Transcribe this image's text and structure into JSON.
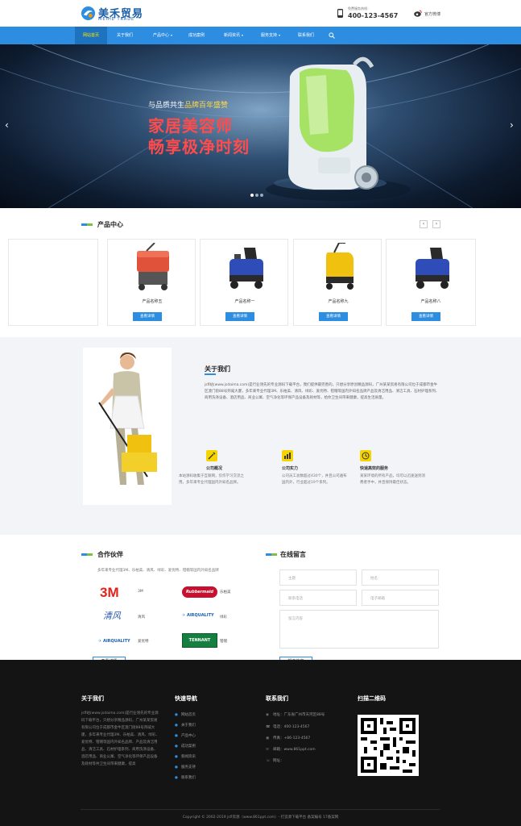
{
  "header": {
    "logo_cn": "美禾贸易",
    "logo_en": "MEIHE TRADE",
    "hotline_label": "免费服务热线：",
    "hotline": "400-123-4567",
    "weibo": "官方微博"
  },
  "nav": {
    "items": [
      {
        "label": "网站首页",
        "dropdown": false
      },
      {
        "label": "关于我们",
        "dropdown": false
      },
      {
        "label": "产品中心",
        "dropdown": true
      },
      {
        "label": "成功案例",
        "dropdown": false
      },
      {
        "label": "新闻资讯",
        "dropdown": true
      },
      {
        "label": "服务支持",
        "dropdown": true
      },
      {
        "label": "联系我们",
        "dropdown": false
      }
    ],
    "search_icon": "search-icon"
  },
  "banner": {
    "sub_a": "与品质共生",
    "sub_b": "品牌百年盛赞",
    "title1": "家居美容师",
    "title2": "畅享极净时刻",
    "prev": "‹",
    "next": "›"
  },
  "products": {
    "title": "产品中心",
    "prev": "‹",
    "next": "›",
    "items": [
      {
        "name": "产品名称五",
        "more": "查看详情"
      },
      {
        "name": "产品名称一",
        "more": "查看详情"
      },
      {
        "name": "产品名称九",
        "more": "查看详情"
      },
      {
        "name": "产品名称八",
        "more": "查看详情"
      }
    ]
  },
  "about": {
    "title": "关于我们",
    "text": "jsfl站(www.jsdaima.com)是行业领先的专业源码下载平台，我们提供最完善的，只想分享原创精品源码，广州某某贸易有限公司位于成都市金牛区澳门街88号邦威大厦，多年来专业代理3M、乐柏美、清风、绿彩、爱优特、钳帽等国内外知名品牌产品及清洁用品、清洁工具、石材护理系列、商用洗涤设备、酒店用品、商业公寓、空气净化等环保产品设备及耗材等，给你卫生间带来健康，提高生活质量。",
    "features": [
      {
        "title": "公司概况",
        "text": "本站源码收集于互联网，仅作学习交流之用。多年来专业代理国内外知名品牌。"
      },
      {
        "title": "公司实力",
        "text": "公司员工总数超过430个，并且公司遍布国内外，行业超过19个系列。"
      },
      {
        "title": "快速高效的服务",
        "text": "某某环境的所有产品，均可以迅速送到消费者手中，并且保持最佳状态。"
      }
    ]
  },
  "partners": {
    "title": "合作伙伴",
    "intro": "多年来专业代理3M、乐柏美、清风、绿彩、爱优特、钳帽等国内外知名品牌",
    "items": [
      {
        "logo": "3M",
        "name": "3M"
      },
      {
        "logo": "Rubbermaid",
        "name": "乐柏美"
      },
      {
        "logo": "清风",
        "name": "清风"
      },
      {
        "logo": "AIRQUALITY",
        "name": "绿彩"
      },
      {
        "logo": "AIRQUALITY",
        "name": "爱优特"
      },
      {
        "logo": "TENNANT",
        "name": "钳帽"
      }
    ],
    "more": "查看详情"
  },
  "message": {
    "title": "在线留言",
    "subject": "主题",
    "name": "姓名",
    "phone": "联系电话",
    "email": "电子邮箱",
    "content": "留言内容",
    "submit": "提交信息"
  },
  "footer": {
    "about_title": "关于我们",
    "about_text": "jsfl站(www.jsdaima.com)是行业领先的专业源码下载平台，只想分享精品源码，广州某某贸易有限公司位于成都市金牛区澳门街88号邦威大厦，多年来专业代理3M、乐柏美、清风、绿彩、爱优特、钳帽等国内外知名品牌、产品及清洁用品、清洁工具、石材护理系列、商用洗涤设备、酒店用品、商业公寓、空气净化等环保产品设备及耗材等共卫生间带来健康，提高",
    "nav_title": "快速导航",
    "nav_links": [
      "网站首页",
      "关于我们",
      "产品中心",
      "成功案例",
      "新闻资讯",
      "服务支持",
      "联系我们"
    ],
    "contact_title": "联系我们",
    "contact": [
      {
        "icon": "◉",
        "text": "地址：广东省广州市天河区88号"
      },
      {
        "icon": "☎",
        "text": "电话：400-123-4567"
      },
      {
        "icon": "▣",
        "text": "传真：+86-123-4567"
      },
      {
        "icon": "✉",
        "text": "邮箱：www.861ppt.com"
      },
      {
        "icon": "☏",
        "text": "网址："
      }
    ],
    "qr_title": "扫描二维码",
    "copyright": "Copyright © 2002-2019 jsfl资源（www.861ppt.com）- 打造源下载平台 备案编号 17备案网"
  },
  "colors": {
    "nav": "#2d8de0",
    "accent_yellow": "#ffe600",
    "banner_title": "#ff4b4b",
    "footer": "#141414"
  }
}
